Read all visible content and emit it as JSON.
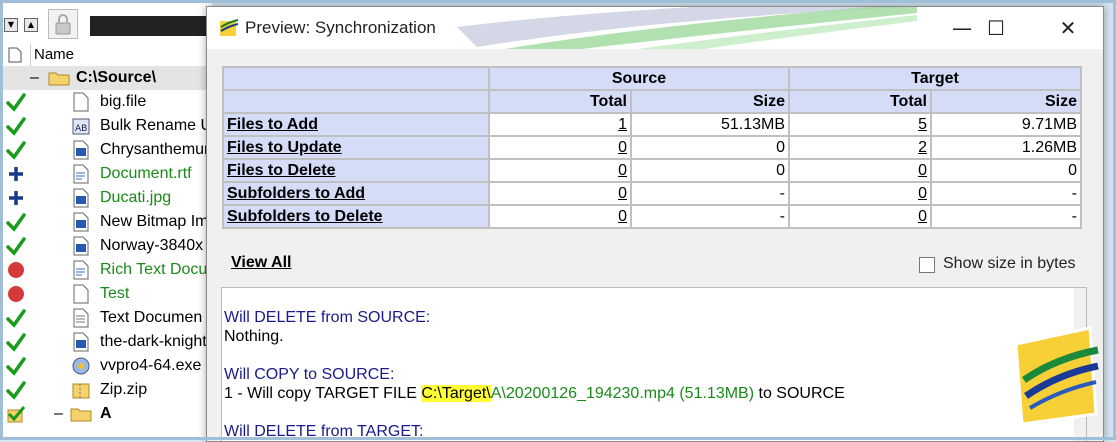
{
  "left_pane": {
    "header_name": "Name",
    "root": "C:\\Source\\",
    "items": [
      {
        "name": "big.file",
        "status": "check",
        "icon": "file-icon",
        "green": false
      },
      {
        "name": "Bulk Rename U",
        "status": "check",
        "icon": "app-icon",
        "green": false
      },
      {
        "name": "Chrysanthemur",
        "status": "check",
        "icon": "image-icon",
        "green": false
      },
      {
        "name": "Document.rtf",
        "status": "plus",
        "icon": "rtf-icon",
        "green": true
      },
      {
        "name": "Ducati.jpg",
        "status": "plus",
        "icon": "image-icon",
        "green": true
      },
      {
        "name": "New Bitmap Im",
        "status": "check",
        "icon": "image-icon",
        "green": false
      },
      {
        "name": "Norway-3840x",
        "status": "check",
        "icon": "image-icon",
        "green": false
      },
      {
        "name": "Rich Text Docu",
        "status": "circle",
        "icon": "rtf-icon",
        "green": true
      },
      {
        "name": "Test",
        "status": "circle",
        "icon": "file-icon",
        "green": true
      },
      {
        "name": "Text Documen",
        "status": "check",
        "icon": "text-icon",
        "green": false
      },
      {
        "name": "the-dark-knight",
        "status": "check",
        "icon": "image-icon",
        "green": false
      },
      {
        "name": "vvpro4-64.exe",
        "status": "check",
        "icon": "exe-icon",
        "green": false
      },
      {
        "name": "Zip.zip",
        "status": "check",
        "icon": "zip-icon",
        "green": false
      }
    ],
    "sub_folder": "A"
  },
  "dialog": {
    "title": "Preview: Synchronization",
    "minimize": "—",
    "maximize": "☐",
    "close": "✕"
  },
  "summary": {
    "source_header": "Source",
    "target_header": "Target",
    "total_header": "Total",
    "size_header": "Size",
    "rows": [
      {
        "label": "Files to Add",
        "src_total": "1",
        "src_size": "51.13MB",
        "tgt_total": "5",
        "tgt_size": "9.71MB"
      },
      {
        "label": "Files to Update",
        "src_total": "0",
        "src_size": "0",
        "tgt_total": "2",
        "tgt_size": "1.26MB"
      },
      {
        "label": "Files to Delete",
        "src_total": "0",
        "src_size": "0",
        "tgt_total": "0",
        "tgt_size": "0"
      },
      {
        "label": "Subfolders to Add",
        "src_total": "0",
        "src_size": "-",
        "tgt_total": "0",
        "tgt_size": "-"
      },
      {
        "label": "Subfolders to Delete",
        "src_total": "0",
        "src_size": "-",
        "tgt_total": "0",
        "tgt_size": "-"
      }
    ]
  },
  "view_all": "View All",
  "show_bytes_label": "Show size in bytes",
  "log": {
    "line1": "Will DELETE from SOURCE:",
    "line2": "Nothing.",
    "line3": "Will COPY to SOURCE:",
    "line4_prefix": "1 - Will copy TARGET FILE ",
    "line4_path_hl": "C:\\Target\\",
    "line4_path_rest": "A\\20200126_194230.mp4 (51.13MB)",
    "line4_suffix": " to SOURCE",
    "line5": "Will DELETE from TARGET:"
  },
  "colors": {
    "header_bg": "#d4dcf7",
    "added_green": "#1a8a1a",
    "log_blue": "#1a1a8c",
    "highlight": "#ffff33"
  }
}
